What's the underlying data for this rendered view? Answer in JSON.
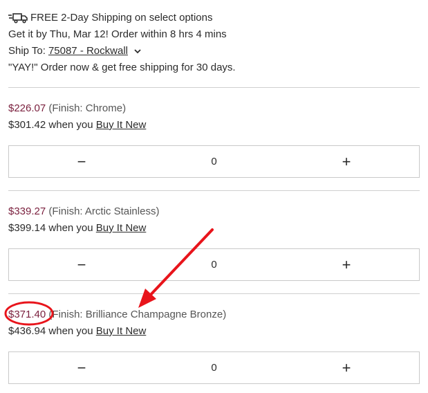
{
  "shipping": {
    "icon": "fast-shipping-truck-icon",
    "free_text": "FREE 2-Day Shipping on select options",
    "get_by": "Get it by Thu, Mar 12! Order within 8 hrs 4 mins",
    "ship_to_label": "Ship To:",
    "ship_to_value": "75087 - Rockwall",
    "promo": "\"YAY!\" Order now & get free shipping for 30 days."
  },
  "offers": [
    {
      "price": "$226.07",
      "finish": "(Finish: Chrome)",
      "new_price": "$301.42",
      "when_text": "when you",
      "buy_link": "Buy It New",
      "qty": "0",
      "minus": "−",
      "plus": "+"
    },
    {
      "price": "$339.27",
      "finish": "(Finish: Arctic Stainless)",
      "new_price": "$399.14",
      "when_text": "when you",
      "buy_link": "Buy It New",
      "qty": "0",
      "minus": "−",
      "plus": "+"
    },
    {
      "price": "$371.40",
      "finish": "(Finish: Brilliance Champagne Bronze)",
      "new_price": "$436.94",
      "when_text": "when you",
      "buy_link": "Buy It New",
      "qty": "0",
      "minus": "−",
      "plus": "+"
    }
  ],
  "annotation": {
    "color": "#e8141b",
    "arrow_icon": "red-arrow-icon",
    "circle_icon": "red-circle-highlight-icon"
  }
}
